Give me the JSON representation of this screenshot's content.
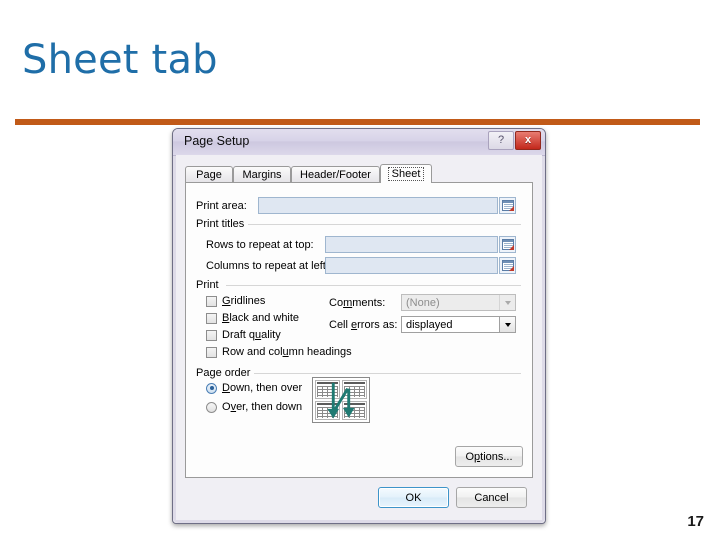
{
  "slide": {
    "title": "Sheet tab",
    "number": "17",
    "accent_color": "#C15A18",
    "title_color": "#1F6EA8"
  },
  "dialog": {
    "title": "Page Setup",
    "help_button": "?",
    "close_button": "x",
    "tabs": [
      {
        "label": "Page",
        "active": false
      },
      {
        "label": "Margins",
        "active": false
      },
      {
        "label": "Header/Footer",
        "active": false
      },
      {
        "label": "Sheet",
        "active": true
      }
    ],
    "print_area": {
      "label": "Print area:",
      "value": "",
      "collapse_icon": "collapse-dialog-icon"
    },
    "print_titles": {
      "group_label": "Print titles",
      "rows_label": "Rows to repeat at top:",
      "rows_value": "",
      "cols_label": "Columns to repeat at left:",
      "cols_value": ""
    },
    "print": {
      "group_label": "Print",
      "checkboxes": [
        {
          "label": "Gridlines",
          "checked": false
        },
        {
          "label": "Black and white",
          "checked": false
        },
        {
          "label": "Draft quality",
          "checked": false
        },
        {
          "label": "Row and column headings",
          "checked": false
        }
      ],
      "comments_label": "Comments:",
      "comments_value": "(None)",
      "comments_disabled": true,
      "cell_errors_label": "Cell errors as:",
      "cell_errors_value": "displayed"
    },
    "page_order": {
      "group_label": "Page order",
      "options": [
        {
          "label": "Down, then over",
          "selected": true
        },
        {
          "label": "Over, then down",
          "selected": false
        }
      ],
      "preview_arrow_color": "#1f7a72"
    },
    "buttons": {
      "options": "Options...",
      "ok": "OK",
      "cancel": "Cancel"
    }
  }
}
